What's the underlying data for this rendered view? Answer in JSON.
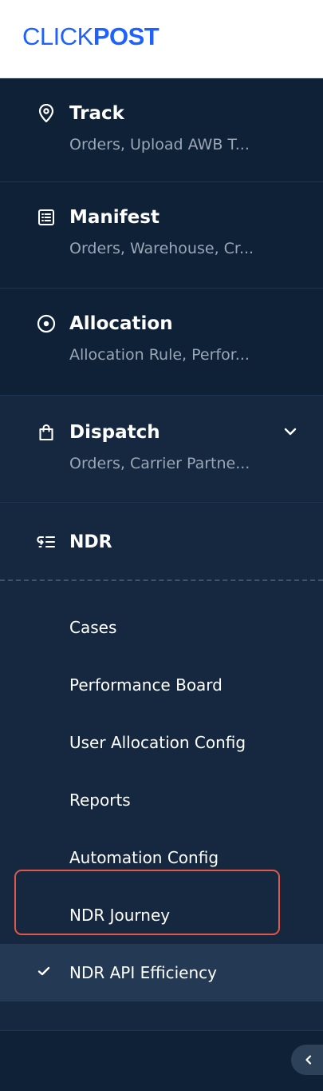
{
  "brand": {
    "logo_light": "CLICK",
    "logo_bold": "POST",
    "color": "#1d61ff"
  },
  "nav": {
    "sections": [
      {
        "icon": "location-pin-icon",
        "title": "Track",
        "subtitle": "Orders, Upload AWB T..."
      },
      {
        "icon": "list-document-icon",
        "title": "Manifest",
        "subtitle": "Orders, Warehouse, Cr..."
      },
      {
        "icon": "target-icon",
        "title": "Allocation",
        "subtitle": "Allocation Rule, Perfor..."
      },
      {
        "icon": "shopping-bag-icon",
        "title": "Dispatch",
        "subtitle": "Orders, Carrier Partne...",
        "expandable": true
      }
    ],
    "ndr": {
      "icon": "return-list-icon",
      "title": "NDR",
      "items": [
        {
          "label": "Cases"
        },
        {
          "label": "Performance Board"
        },
        {
          "label": "User Allocation Config"
        },
        {
          "label": "Reports"
        },
        {
          "label": "Automation Config"
        },
        {
          "label": "NDR Journey"
        },
        {
          "label": "NDR API Efficiency",
          "active": true
        }
      ]
    },
    "collapse_icon": "chevron-left-icon",
    "highlight_color": "#e0574c"
  }
}
